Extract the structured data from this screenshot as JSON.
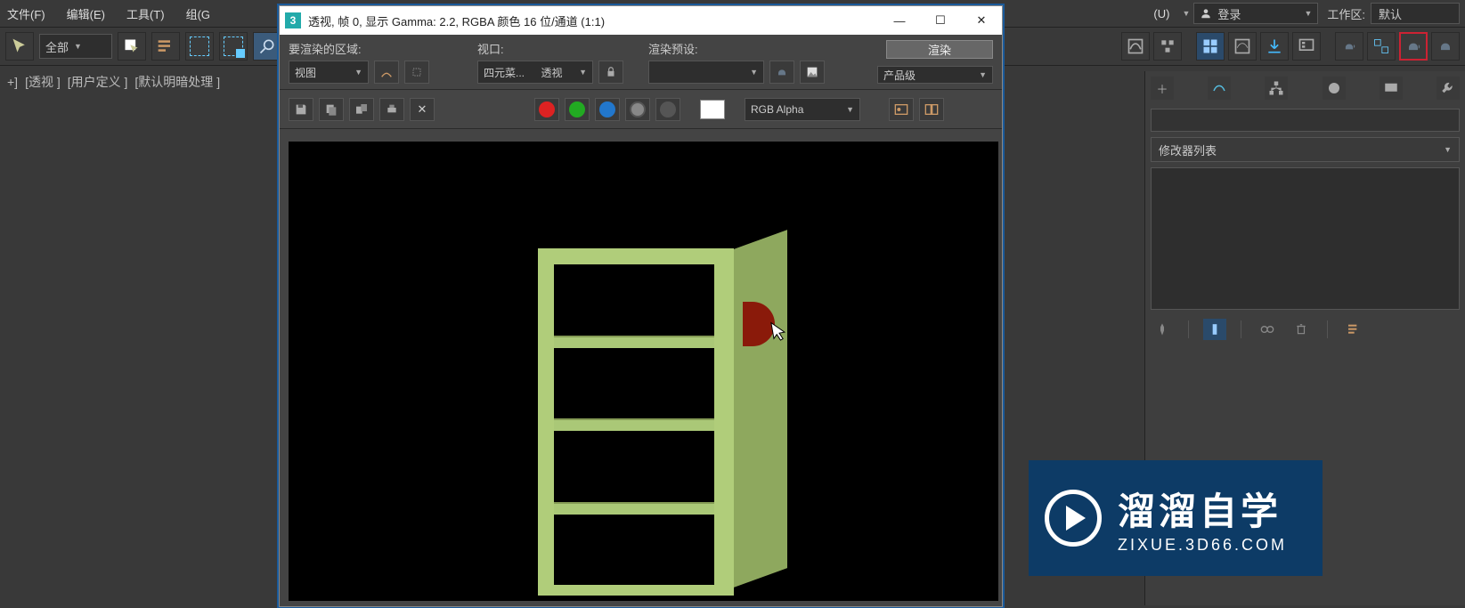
{
  "menu": {
    "file": "文件(F)",
    "edit": "编辑(E)",
    "tools": "工具(T)",
    "group": "组(G",
    "u": "(U)"
  },
  "topright": {
    "login": "登录",
    "workspace_label": "工作区:",
    "workspace_value": "默认"
  },
  "toolbar": {
    "selection_mode": "全部"
  },
  "viewport_labels": {
    "l1": "+]",
    "l2": "[透视 ]",
    "l3": "[用户定义 ]",
    "l4": "[默认明暗处理 ]"
  },
  "render_window": {
    "title": "透视, 帧 0, 显示 Gamma: 2.2, RGBA 颜色 16 位/通道 (1:1)",
    "icon_text": "3",
    "row1": {
      "area_label": "要渲染的区域:",
      "area_value": "视图",
      "viewport_label": "视口:",
      "viewport_left": "四元菜...",
      "viewport_right": "透视",
      "preset_label": "渲染预设:",
      "render_btn": "渲染",
      "production": "产品级"
    },
    "row2": {
      "alpha": "RGB Alpha"
    }
  },
  "right_panel": {
    "name": "",
    "mod_list_label": "修改器列表"
  },
  "watermark": {
    "big": "溜溜自学",
    "small": "ZIXUE.3D66.COM"
  }
}
